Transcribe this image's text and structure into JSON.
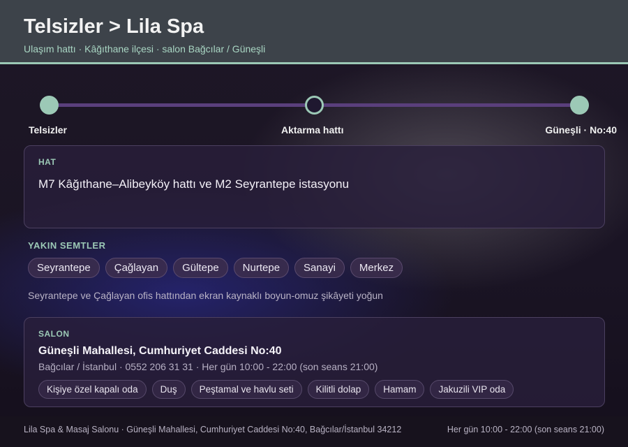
{
  "header": {
    "title": "Telsizler > Lila Spa",
    "subtitle": "Ulaşım hattı · Kâğıthane ilçesi · salon Bağcılar / Güneşli"
  },
  "steps": [
    {
      "label": "Telsizler",
      "state": "done"
    },
    {
      "label": "Aktarma hattı",
      "state": "current"
    },
    {
      "label": "Güneşli · No:40",
      "state": "done"
    }
  ],
  "hat": {
    "label": "HAT",
    "text": "M7 Kâğıthane–Alibeyköy hattı ve M2 Seyrantepe istasyonu"
  },
  "semtler": {
    "heading": "YAKIN SEMTLER",
    "items": [
      "Seyrantepe",
      "Çağlayan",
      "Gültepe",
      "Nurtepe",
      "Sanayi",
      "Merkez"
    ],
    "note": "Seyrantepe ve Çağlayan ofis hattından ekran kaynaklı boyun-omuz şikâyeti yoğun"
  },
  "salon": {
    "label": "SALON",
    "address": "Güneşli Mahallesi, Cumhuriyet Caddesi No:40",
    "meta": "Bağcılar / İstanbul · 0552 206 31 31 · Her gün 10:00 - 22:00 (son seans 21:00)",
    "amenities": [
      "Kişiye özel kapalı oda",
      "Duş",
      "Peştamal ve havlu seti",
      "Kilitli dolap",
      "Hamam",
      "Jakuzili VIP oda"
    ]
  },
  "footer": {
    "left": "Lila Spa & Masaj Salonu · Güneşli Mahallesi, Cumhuriyet Caddesi No:40, Bağcılar/İstanbul 34212",
    "right": "Her gün 10:00 - 22:00 (son seans 21:00)"
  },
  "colors": {
    "accent": "#9cc9b6",
    "header_bg": "#3d434a",
    "track": "#5a3f7c"
  }
}
